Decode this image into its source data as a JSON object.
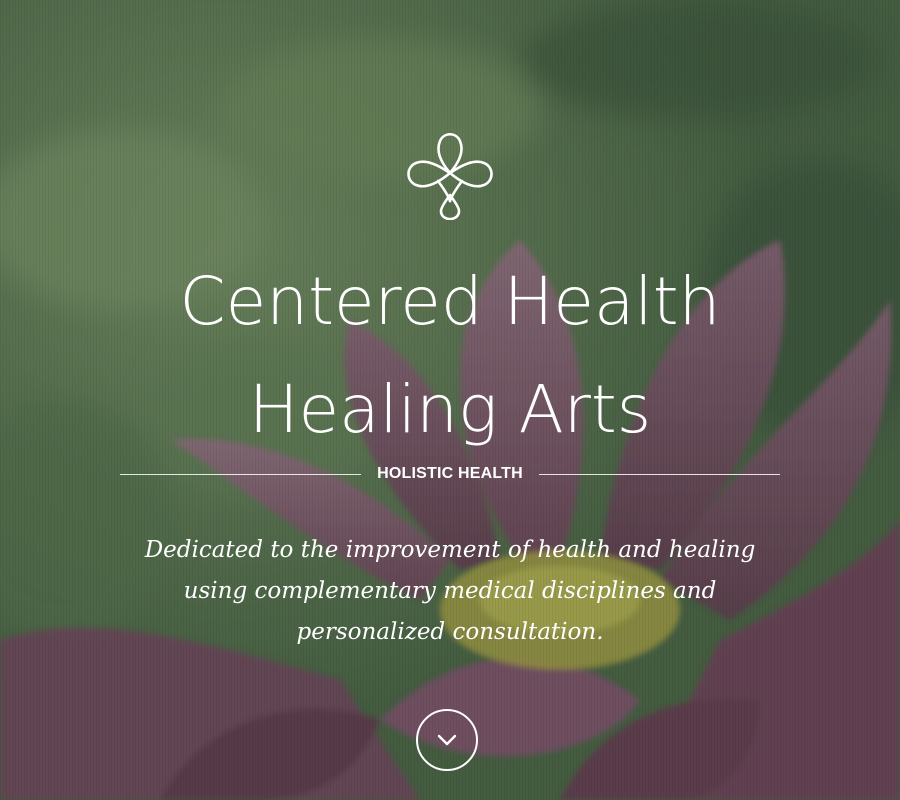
{
  "hero": {
    "logo_icon": "celtic-knot-icon",
    "title_line_1": "Centered Health",
    "title_line_2": "Healing Arts",
    "tag": "HOLISTIC HEALTH",
    "tagline": "Dedicated to the improvement of health and healing using complementary medical disciplines and personalized consultation.",
    "scroll_icon": "chevron-down-icon"
  },
  "colors": {
    "overlay_green": "#4f6a4a",
    "petal": "#8a4c6a",
    "stamen": "#c9c24a",
    "text": "#ffffff"
  }
}
